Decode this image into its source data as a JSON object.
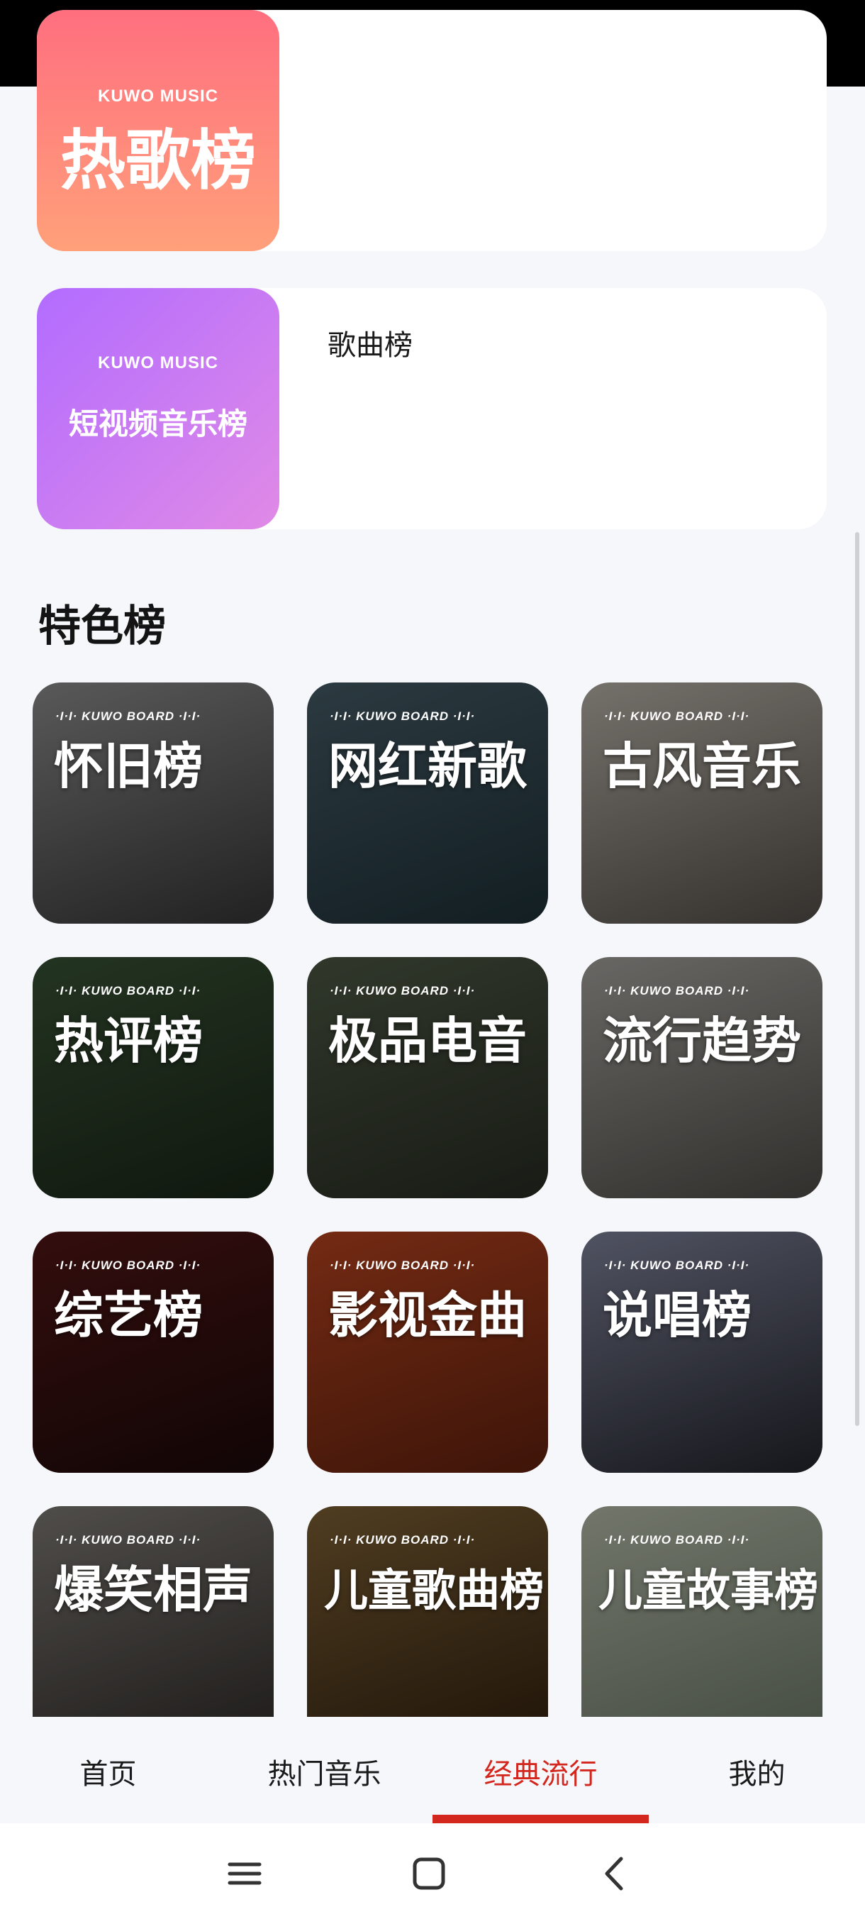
{
  "charts": [
    {
      "cover_logo": "KUWO MUSIC",
      "cover_title": "热歌榜",
      "subtitle": ""
    },
    {
      "cover_logo": "KUWO MUSIC",
      "cover_title": "短视频音乐榜",
      "subtitle": "歌曲榜"
    }
  ],
  "section_title": "特色榜",
  "board_label": "·I·I· KUWO BOARD ·I·I·",
  "tiles": [
    {
      "name": "怀旧榜",
      "color_a": "#9a9a9a",
      "color_b": "#3a3a3a"
    },
    {
      "name": "网红新歌",
      "color_a": "#4c6470",
      "color_b": "#20343a"
    },
    {
      "name": "古风音乐",
      "color_a": "#c9c2b8",
      "color_b": "#5b5650"
    },
    {
      "name": "热评榜",
      "color_a": "#3e5a3a",
      "color_b": "#1c2a1a"
    },
    {
      "name": "极品电音",
      "color_a": "#54604a",
      "color_b": "#2a3026"
    },
    {
      "name": "流行趋势",
      "color_a": "#b4b2ac",
      "color_b": "#55534e"
    },
    {
      "name": "综艺榜",
      "color_a": "#5a1818",
      "color_b": "#1e0a0a"
    },
    {
      "name": "影视金曲",
      "color_a": "#c84a22",
      "color_b": "#6a2410"
    },
    {
      "name": "说唱榜",
      "color_a": "#8a8fa8",
      "color_b": "#262830"
    },
    {
      "name": "爆笑相声",
      "color_a": "#8a8680",
      "color_b": "#3c3834"
    },
    {
      "name": "儿童歌曲榜",
      "color_a": "#8a6a3a",
      "color_b": "#3e2a14"
    },
    {
      "name": "儿童故事榜",
      "color_a": "#c4ccb8",
      "color_b": "#7e8a78"
    }
  ],
  "tabs": [
    {
      "label": "首页",
      "active": false
    },
    {
      "label": "热门音乐",
      "active": false
    },
    {
      "label": "经典流行",
      "active": true
    },
    {
      "label": "我的",
      "active": false
    }
  ],
  "colors": {
    "accent": "#d3261c",
    "background": "#f6f7fb"
  }
}
